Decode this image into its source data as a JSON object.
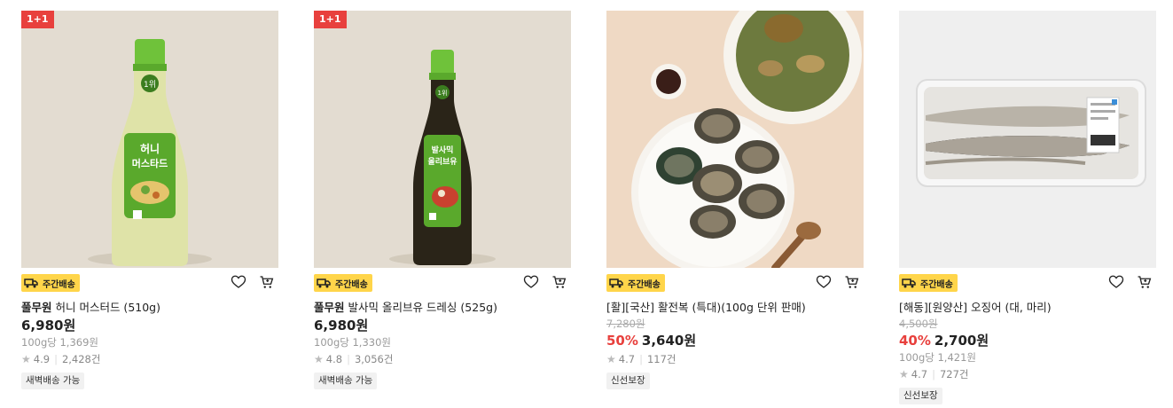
{
  "products": [
    {
      "promo_badge": "1+1",
      "delivery_badge": "주간배송",
      "brand": "풀무원",
      "name": " 허니 머스터드 (510g)",
      "original_price": "",
      "discount": "",
      "price": "6,980원",
      "unit_price": "100g당 1,369원",
      "rating": "4.9",
      "reviews": "2,428건",
      "tag": "새벽배송 가능",
      "bottle_label_line1": "허니",
      "bottle_label_line2": "머스타드",
      "bottle_cap_text": "1위",
      "colors": {
        "bg": "#e3dcd1",
        "bottle": "#dfe3a8",
        "cap": "#6fc23a"
      }
    },
    {
      "promo_badge": "1+1",
      "delivery_badge": "주간배송",
      "brand": "풀무원",
      "name": " 발사믹 올리브유 드레싱 (525g)",
      "original_price": "",
      "discount": "",
      "price": "6,980원",
      "unit_price": "100g당 1,330원",
      "rating": "4.8",
      "reviews": "3,056건",
      "tag": "새벽배송 가능",
      "bottle_label_line1": "발사믹",
      "bottle_label_line2": "올리브유",
      "bottle_cap_text": "1위",
      "colors": {
        "bg": "#e3dcd1",
        "bottle": "#2a2418",
        "cap": "#6fc23a"
      }
    },
    {
      "promo_badge": "",
      "delivery_badge": "주간배송",
      "brand": "",
      "name": "[활][국산] 활전복 (특대)(100g 단위 판매)",
      "original_price": "7,280원",
      "discount": "50%",
      "price": "3,640원",
      "unit_price": "",
      "rating": "4.7",
      "reviews": "117건",
      "tag": "신선보장",
      "colors": {
        "bg": "#efd9c4",
        "plate": "#f6f3ee"
      }
    },
    {
      "promo_badge": "",
      "delivery_badge": "주간배송",
      "brand": "",
      "name": "[해동][원양산] 오징어 (대, 마리)",
      "original_price": "4,500원",
      "discount": "40%",
      "price": "2,700원",
      "unit_price": "100g당 1,421원",
      "rating": "4.7",
      "reviews": "727건",
      "tag": "신선보장",
      "colors": {
        "bg": "#efefef",
        "tray": "#fafafa",
        "squid": "#b9b3a8"
      }
    }
  ]
}
